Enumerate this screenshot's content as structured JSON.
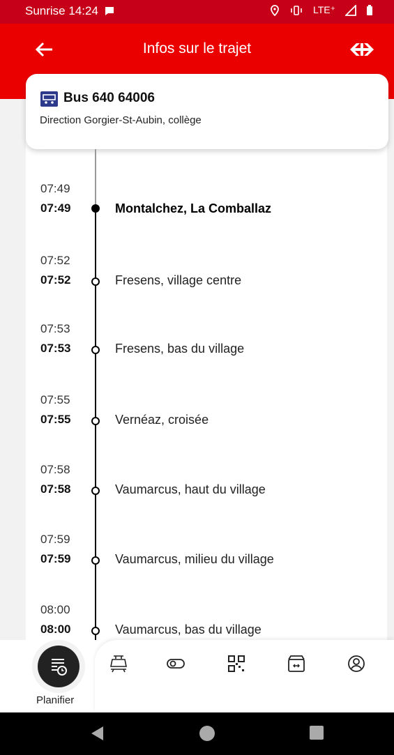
{
  "status_bar": {
    "time_label": "Sunrise 14:24",
    "network": "LTE⁺"
  },
  "app_bar": {
    "title": "Infos sur le trajet"
  },
  "journey": {
    "line": "Bus 640 64006",
    "direction": "Direction Gorgier-St-Aubin, collège"
  },
  "stops": [
    {
      "planned": "07:49",
      "actual": "07:49",
      "name": "Montalchez, La Comballaz",
      "current": true
    },
    {
      "planned": "07:52",
      "actual": "07:52",
      "name": "Fresens, village centre",
      "current": false
    },
    {
      "planned": "07:53",
      "actual": "07:53",
      "name": "Fresens, bas du village",
      "current": false
    },
    {
      "planned": "07:55",
      "actual": "07:55",
      "name": "Vernéaz, croisée",
      "current": false
    },
    {
      "planned": "07:58",
      "actual": "07:58",
      "name": "Vaumarcus, haut du village",
      "current": false
    },
    {
      "planned": "07:59",
      "actual": "07:59",
      "name": "Vaumarcus, milieu du village",
      "current": false
    },
    {
      "planned": "08:00",
      "actual": "08:00",
      "name": "Vaumarcus, bas du village",
      "current": false
    }
  ],
  "bottom_nav": {
    "planifier_label": "Planifier",
    "items": [
      "planifier-icon",
      "train-ticket-icon",
      "toggle-icon",
      "qr-code-icon",
      "shop-ticket-icon",
      "account-icon"
    ]
  },
  "colors": {
    "brand_red": "#eb0000",
    "status_red": "#c60018"
  }
}
